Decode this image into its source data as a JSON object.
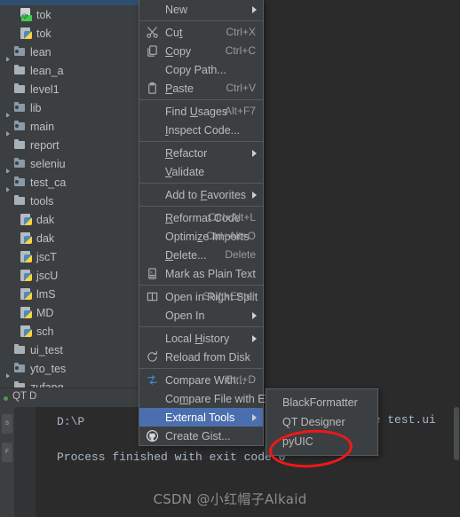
{
  "app": {
    "theme_bg": "#2b2b2b",
    "panel_bg": "#3c3f41",
    "accent": "#4b6eaf",
    "annotation_color": "#f01818"
  },
  "project_tree": {
    "items": [
      {
        "label": "tok",
        "icon": "qt-designer-file-icon",
        "indent": 1,
        "expandable": false
      },
      {
        "label": "tok",
        "icon": "python-file-icon",
        "indent": 1,
        "expandable": false
      },
      {
        "label": "lean",
        "icon": "folder-icon",
        "indent": 0,
        "expandable": true
      },
      {
        "label": "lean_a",
        "icon": "folder-icon",
        "indent": 0,
        "expandable": false
      },
      {
        "label": "level1",
        "icon": "folder-icon",
        "indent": 0,
        "expandable": false
      },
      {
        "label": "lib",
        "icon": "folder-icon",
        "indent": 0,
        "expandable": true
      },
      {
        "label": "main",
        "icon": "folder-icon",
        "indent": 0,
        "expandable": true
      },
      {
        "label": "report",
        "icon": "folder-icon",
        "indent": 0,
        "expandable": false
      },
      {
        "label": "seleniu",
        "icon": "folder-icon",
        "indent": 0,
        "expandable": true
      },
      {
        "label": "test_ca",
        "icon": "folder-icon",
        "indent": 0,
        "expandable": true
      },
      {
        "label": "tools",
        "icon": "folder-icon",
        "indent": 0,
        "expandable": false
      },
      {
        "label": "dak",
        "icon": "python-file-icon",
        "indent": 1,
        "expandable": false
      },
      {
        "label": "dak",
        "icon": "python-file-icon",
        "indent": 1,
        "expandable": false
      },
      {
        "label": "jscT",
        "icon": "python-file-icon",
        "indent": 1,
        "expandable": false
      },
      {
        "label": "jscU",
        "icon": "python-file-icon",
        "indent": 1,
        "expandable": false
      },
      {
        "label": "lmS",
        "icon": "python-file-icon",
        "indent": 1,
        "expandable": false
      },
      {
        "label": "MD",
        "icon": "python-file-icon",
        "indent": 1,
        "expandable": false
      },
      {
        "label": "sch",
        "icon": "python-file-icon",
        "indent": 1,
        "expandable": false
      },
      {
        "label": "ui_test",
        "icon": "folder-icon",
        "indent": 0,
        "expandable": false
      },
      {
        "label": "yto_tes",
        "icon": "folder-icon",
        "indent": 0,
        "expandable": true
      },
      {
        "label": "zufang",
        "icon": "folder-icon",
        "indent": 0,
        "expandable": false
      }
    ]
  },
  "run_panel": {
    "tab_label": "QT D",
    "console_line_1": "D:\\P",
    "console_line_2": "Process finished with exit code 0",
    "editor_text_right": "exe test.ui"
  },
  "context_menu": {
    "items": [
      {
        "label": "New",
        "accel": "",
        "icon": "",
        "submenu": true,
        "selected": false,
        "mnemonic": ""
      },
      {
        "type": "separator"
      },
      {
        "label": "Cut",
        "accel": "Ctrl+X",
        "icon": "scissors-icon",
        "submenu": false,
        "selected": false,
        "mnemonic": "t"
      },
      {
        "label": "Copy",
        "accel": "Ctrl+C",
        "icon": "copy-icon",
        "submenu": false,
        "selected": false,
        "mnemonic": "C"
      },
      {
        "label": "Copy Path...",
        "accel": "",
        "icon": "",
        "submenu": false,
        "selected": false,
        "mnemonic": ""
      },
      {
        "label": "Paste",
        "accel": "Ctrl+V",
        "icon": "clipboard-icon",
        "submenu": false,
        "selected": false,
        "mnemonic": "P"
      },
      {
        "type": "separator"
      },
      {
        "label": "Find Usages",
        "accel": "Alt+F7",
        "icon": "",
        "submenu": false,
        "selected": false,
        "mnemonic": "U"
      },
      {
        "label": "Inspect Code...",
        "accel": "",
        "icon": "",
        "submenu": false,
        "selected": false,
        "mnemonic": "I"
      },
      {
        "type": "separator"
      },
      {
        "label": "Refactor",
        "accel": "",
        "icon": "",
        "submenu": true,
        "selected": false,
        "mnemonic": "R"
      },
      {
        "label": "Validate",
        "accel": "",
        "icon": "",
        "submenu": false,
        "selected": false,
        "mnemonic": "V"
      },
      {
        "type": "separator"
      },
      {
        "label": "Add to Favorites",
        "accel": "",
        "icon": "",
        "submenu": true,
        "selected": false,
        "mnemonic": "F"
      },
      {
        "type": "separator"
      },
      {
        "label": "Reformat Code",
        "accel": "Ctrl+Alt+L",
        "icon": "",
        "submenu": false,
        "selected": false,
        "mnemonic": "R"
      },
      {
        "label": "Optimize Imports",
        "accel": "Ctrl+Alt+O",
        "icon": "",
        "submenu": false,
        "selected": false,
        "mnemonic": "z"
      },
      {
        "label": "Delete...",
        "accel": "Delete",
        "icon": "",
        "submenu": false,
        "selected": false,
        "mnemonic": "D"
      },
      {
        "label": "Mark as Plain Text",
        "accel": "",
        "icon": "plain-text-icon",
        "submenu": false,
        "selected": false,
        "mnemonic": ""
      },
      {
        "type": "separator"
      },
      {
        "label": "Open in Right Split",
        "accel": "Shift+Enter",
        "icon": "split-icon",
        "submenu": false,
        "selected": false,
        "mnemonic": ""
      },
      {
        "label": "Open In",
        "accel": "",
        "icon": "",
        "submenu": true,
        "selected": false,
        "mnemonic": ""
      },
      {
        "type": "separator"
      },
      {
        "label": "Local History",
        "accel": "",
        "icon": "",
        "submenu": true,
        "selected": false,
        "mnemonic": "H"
      },
      {
        "label": "Reload from Disk",
        "accel": "",
        "icon": "refresh-icon",
        "submenu": false,
        "selected": false,
        "mnemonic": ""
      },
      {
        "type": "separator"
      },
      {
        "label": "Compare With...",
        "accel": "Ctrl+D",
        "icon": "compare-icon",
        "submenu": false,
        "selected": false,
        "mnemonic": ""
      },
      {
        "label": "Compare File with Editor",
        "accel": "",
        "icon": "",
        "submenu": false,
        "selected": false,
        "mnemonic": "m"
      },
      {
        "label": "External Tools",
        "accel": "",
        "icon": "",
        "submenu": true,
        "selected": true,
        "mnemonic": ""
      },
      {
        "label": "Create Gist...",
        "accel": "",
        "icon": "github-icon",
        "submenu": false,
        "selected": false,
        "mnemonic": ""
      }
    ]
  },
  "submenu": {
    "title": "External Tools",
    "items": [
      {
        "label": "BlackFormatter"
      },
      {
        "label": "QT Designer"
      },
      {
        "label": "pyUIC",
        "annotated": true
      }
    ]
  },
  "rail": {
    "buttons": [
      "structure",
      "favorites"
    ]
  },
  "watermark": {
    "text": "CSDN @小红帽子Alkaid"
  }
}
